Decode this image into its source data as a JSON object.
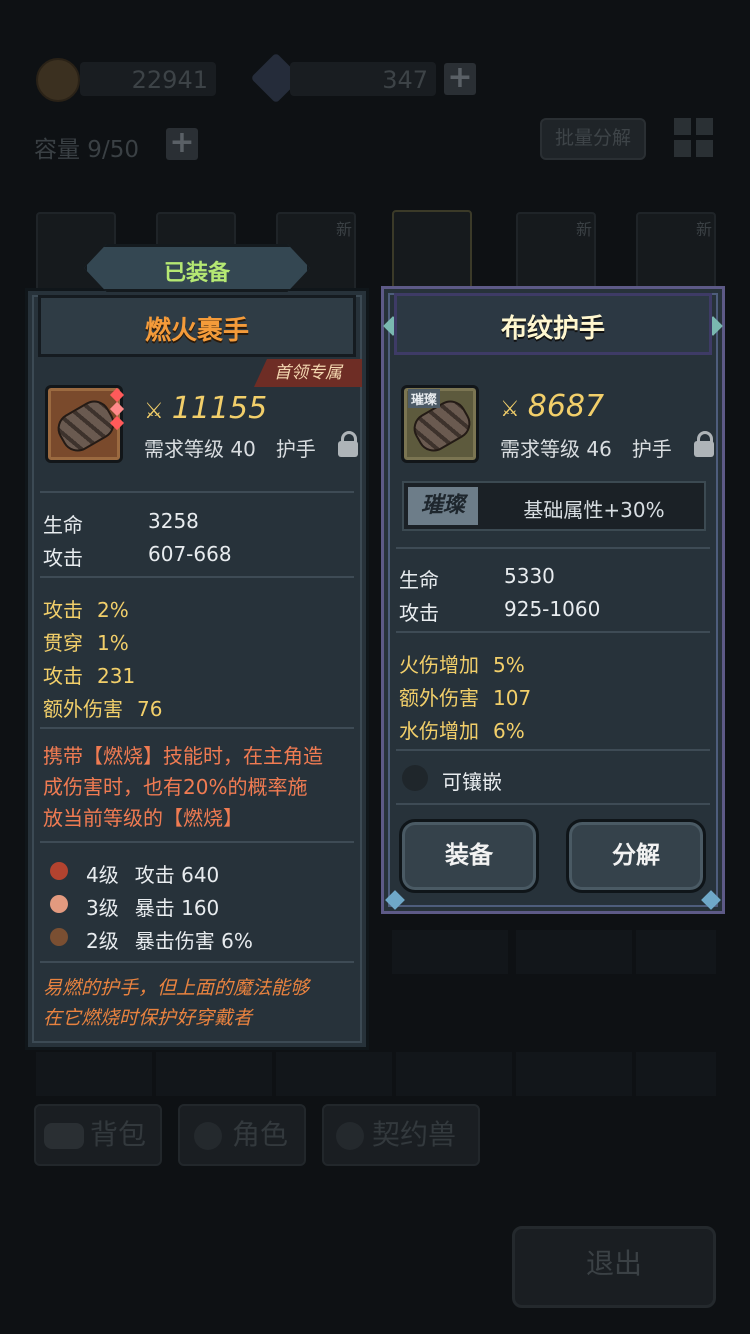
{
  "background": {
    "gold_value": "22941",
    "gem_value": "347",
    "capacity": "容量 9/50",
    "batch_decompose": "批量分解",
    "new_badge": "新",
    "tabs": [
      "背包",
      "角色",
      "契约兽"
    ],
    "exit": "退出"
  },
  "equipped_panel": {
    "header_tab": "已装备",
    "title": "燃火裹手",
    "boss_tag": "首领专属",
    "score": "11155",
    "req_level": "需求等级 40",
    "slot": "护手",
    "base_stats": [
      {
        "label": "生命",
        "value": "3258"
      },
      {
        "label": "攻击",
        "value": "607-668"
      }
    ],
    "bonus_stats": [
      {
        "label": "攻击",
        "value": "2%"
      },
      {
        "label": "贯穿",
        "value": "1%"
      },
      {
        "label": "攻击",
        "value": "231"
      },
      {
        "label": "额外伤害",
        "value": "76"
      }
    ],
    "skill_line1": "携带【燃烧】技能时，在主角造",
    "skill_line2": "成伤害时，也有20%的概率施",
    "skill_line3": "放当前等级的【燃烧】",
    "gems": [
      {
        "level": "4级",
        "effect": "攻击 640",
        "color": "#b2432f"
      },
      {
        "level": "3级",
        "effect": "暴击 160",
        "color": "#e39a7f"
      },
      {
        "level": "2级",
        "effect": "暴击伤害 6%",
        "color": "#7a4f32"
      }
    ],
    "flavor_line1": "易燃的护手，但上面的魔法能够",
    "flavor_line2": "在它燃烧时保护好穿戴者"
  },
  "compare_panel": {
    "title": "布纹护手",
    "score": "8687",
    "req_level": "需求等级 46",
    "slot": "护手",
    "icon_tag": "璀璨",
    "brilliant_tag": "璀璨",
    "brilliant_text": "基础属性+30%",
    "base_stats": [
      {
        "label": "生命",
        "value": "5330"
      },
      {
        "label": "攻击",
        "value": "925-1060"
      }
    ],
    "bonus_stats": [
      {
        "label": "火伤增加",
        "value": "5%"
      },
      {
        "label": "额外伤害",
        "value": "107"
      },
      {
        "label": "水伤增加",
        "value": "6%"
      }
    ],
    "socket_label": "可镶嵌",
    "equip_button": "装备",
    "decompose_button": "分解"
  },
  "colors": {
    "orange_title": "#f49b3a",
    "gold": "#f2cf6a",
    "skill_red": "#f07b52",
    "header_green": "#b5e873"
  }
}
